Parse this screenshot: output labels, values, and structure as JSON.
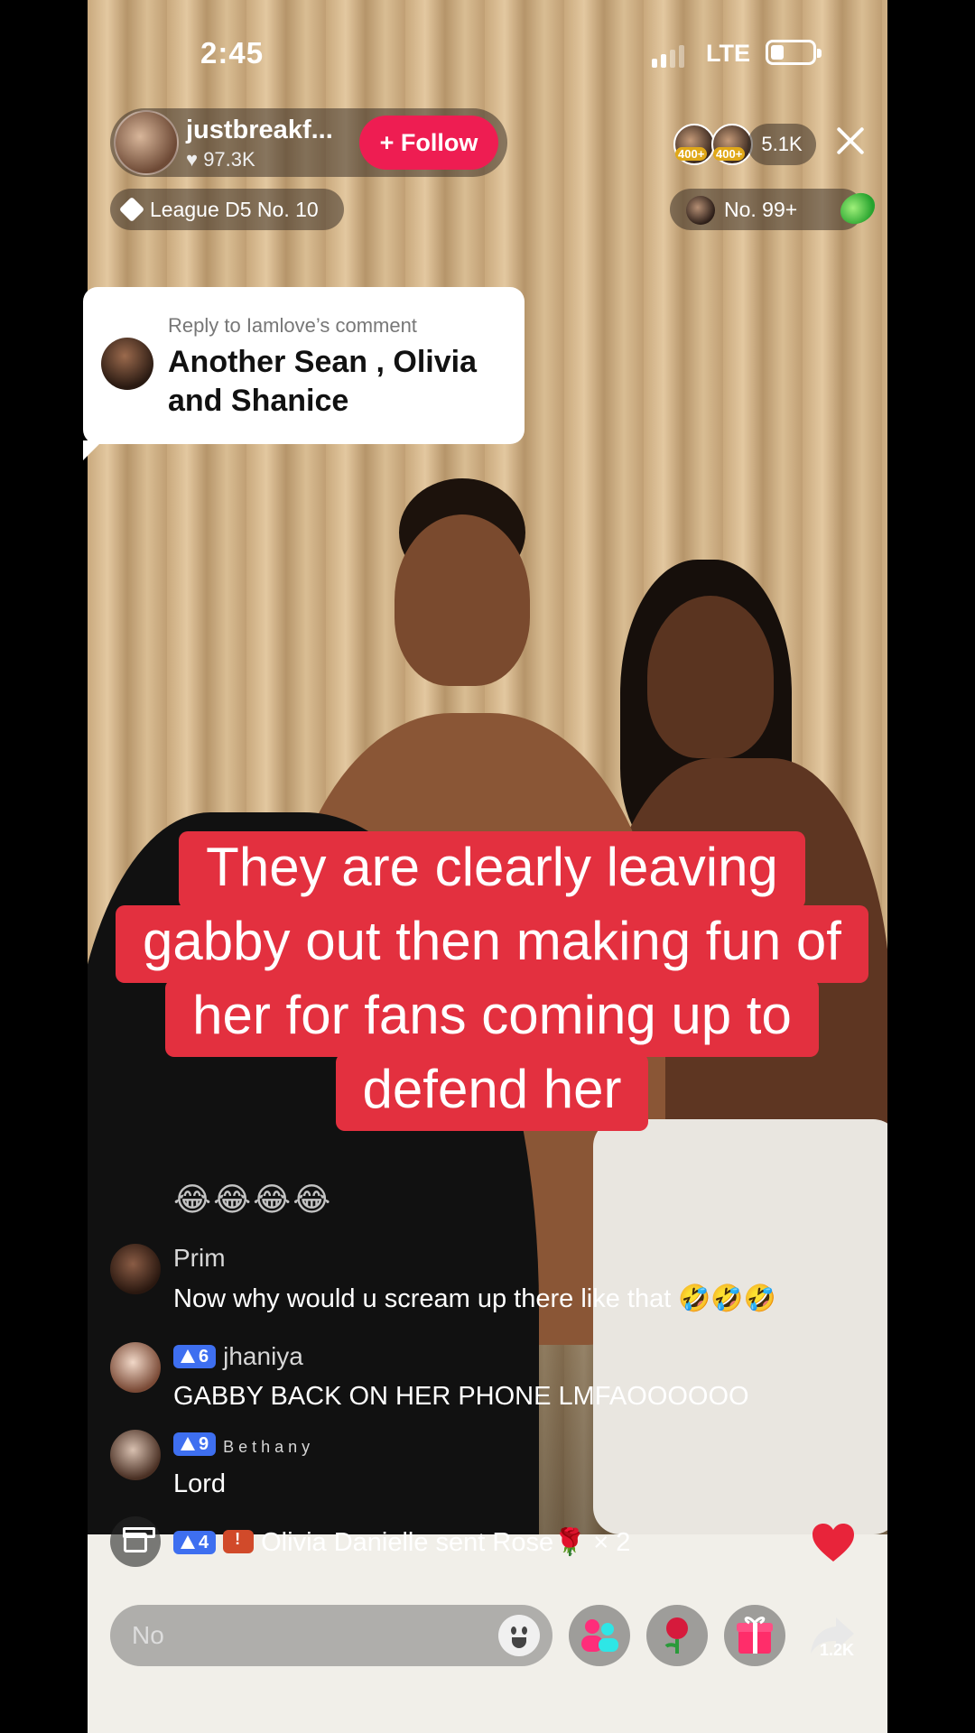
{
  "status_bar": {
    "time": "2:45",
    "network": "LTE"
  },
  "host": {
    "name": "justbreakf...",
    "likes": "97.3K",
    "follow_label": "+ Follow"
  },
  "viewers": {
    "badges": [
      "400+",
      "400+"
    ],
    "count": "5.1K"
  },
  "league": {
    "label": "League D5 No. 10"
  },
  "rank": {
    "label": "No. 99+"
  },
  "reply_card": {
    "label": "Reply to Iamlove’s comment",
    "text": "Another Sean , Olivia and Shanice"
  },
  "caption": {
    "lines": [
      "They are clearly leaving",
      "gabby out then making fun of",
      "her for fans coming up to",
      "defend her"
    ]
  },
  "comments": {
    "emoji_row": "😂😂😂😂",
    "items": [
      {
        "name": "Prim",
        "level": "",
        "text": "Now why would u scream up there like that 🤣🤣🤣"
      },
      {
        "name": "jhaniya",
        "level": "6",
        "text": "GABBY BACK ON HER PHONE LMFAOOOOOO"
      },
      {
        "name": "Bethany",
        "level": "9",
        "text": "Lord"
      }
    ]
  },
  "gift_event": {
    "level": "4",
    "user": "Olivia Danielle",
    "action": "sent Rose🌹",
    "count": "× 2"
  },
  "bottom_bar": {
    "input_placeholder": "No",
    "share_count": "1.2K"
  },
  "colors": {
    "follow": "#ee1d52",
    "caption_bg": "#e3303f",
    "level_badge": "#3e6ff0",
    "heart": "#e8243a"
  },
  "icons": [
    "diamond-icon",
    "gem-icon",
    "close-icon",
    "gift-icon",
    "heart-icon",
    "emoji-icon",
    "multi-guest-icon",
    "rose-icon",
    "gift-box-icon",
    "share-icon"
  ]
}
